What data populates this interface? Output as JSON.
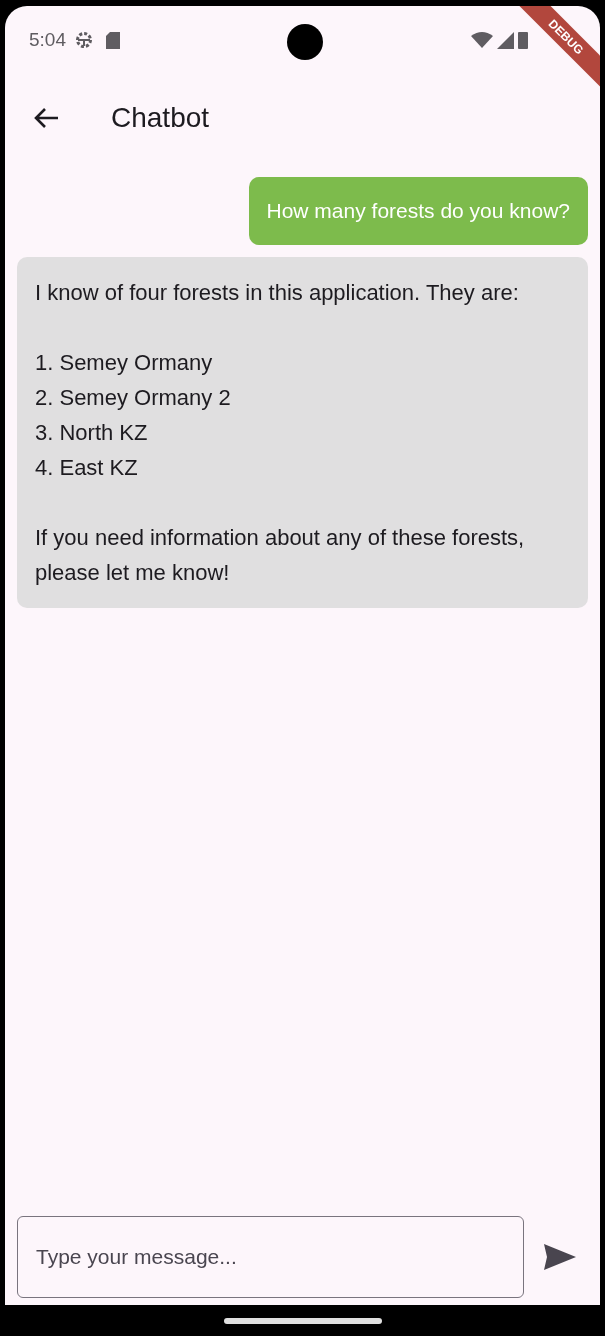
{
  "status_bar": {
    "time": "5:04"
  },
  "debug_banner": "DEBUG",
  "app_bar": {
    "title": "Chatbot"
  },
  "messages": [
    {
      "kind": "user",
      "text": "How many forests do you know?"
    },
    {
      "kind": "bot",
      "text": "I know of four forests in this application. They are:\n\n1. Semey Ormany\n2. Semey Ormany 2\n3. North KZ\n4. East KZ\n\nIf you need information about any of these forests, please let me know!"
    }
  ],
  "composer": {
    "placeholder": "Type your message..."
  }
}
